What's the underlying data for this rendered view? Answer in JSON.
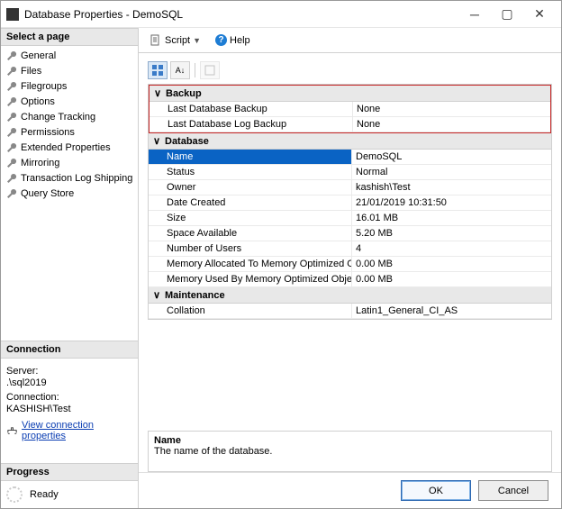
{
  "window": {
    "title": "Database Properties - DemoSQL"
  },
  "left": {
    "select_page": "Select a page",
    "pages": [
      "General",
      "Files",
      "Filegroups",
      "Options",
      "Change Tracking",
      "Permissions",
      "Extended Properties",
      "Mirroring",
      "Transaction Log Shipping",
      "Query Store"
    ],
    "connection_heading": "Connection",
    "server_label": "Server:",
    "server_value": ".\\sql2019",
    "connection_label": "Connection:",
    "connection_value": "KASHISH\\Test",
    "view_props": "View connection properties",
    "progress_heading": "Progress",
    "progress_status": "Ready"
  },
  "toolbar": {
    "script": "Script",
    "help": "Help"
  },
  "grid": {
    "categories": [
      {
        "name": "Backup",
        "highlighted": true,
        "rows": [
          {
            "label": "Last Database Backup",
            "value": "None"
          },
          {
            "label": "Last Database Log Backup",
            "value": "None"
          }
        ]
      },
      {
        "name": "Database",
        "rows": [
          {
            "label": "Name",
            "value": "DemoSQL",
            "selected": true
          },
          {
            "label": "Status",
            "value": "Normal"
          },
          {
            "label": "Owner",
            "value": "kashish\\Test"
          },
          {
            "label": "Date Created",
            "value": "21/01/2019 10:31:50"
          },
          {
            "label": "Size",
            "value": "16.01 MB"
          },
          {
            "label": "Space Available",
            "value": "5.20 MB"
          },
          {
            "label": "Number of Users",
            "value": "4"
          },
          {
            "label": "Memory Allocated To Memory Optimized Ob",
            "value": "0.00 MB"
          },
          {
            "label": "Memory Used By Memory Optimized Objects",
            "value": "0.00 MB"
          }
        ]
      },
      {
        "name": "Maintenance",
        "rows": [
          {
            "label": "Collation",
            "value": "Latin1_General_CI_AS"
          }
        ]
      }
    ]
  },
  "description": {
    "title": "Name",
    "text": "The name of the database."
  },
  "buttons": {
    "ok": "OK",
    "cancel": "Cancel"
  }
}
